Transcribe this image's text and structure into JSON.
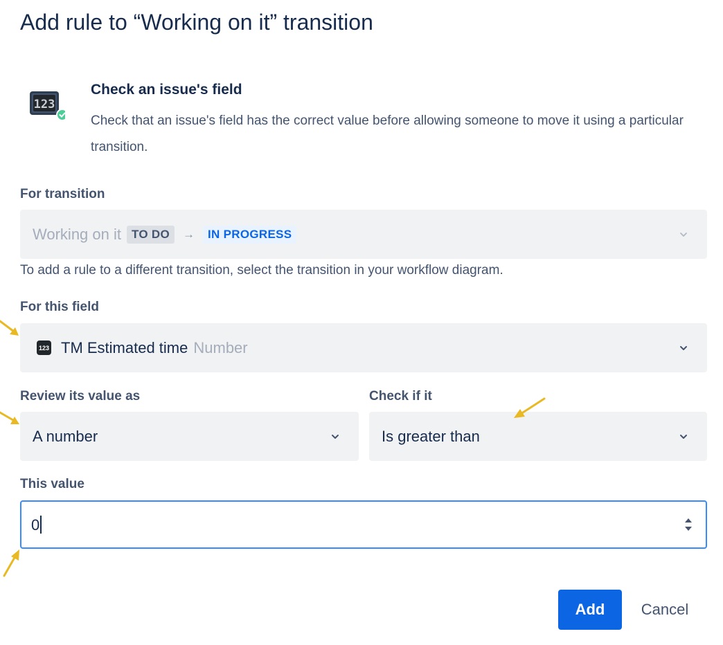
{
  "dialog": {
    "title": "Add rule to “Working on it” transition"
  },
  "rule": {
    "icon": "calculator-check-icon",
    "title": "Check an issue's field",
    "description": "Check that an issue's field has the correct value before allowing someone to move it using a particular transition."
  },
  "transition": {
    "label": "For transition",
    "name": "Working on it",
    "from_status": "TO DO",
    "to_status": "IN PROGRESS",
    "helper": "To add a rule to a different transition, select the transition in your workflow diagram."
  },
  "field": {
    "label": "For this field",
    "icon": "number-field-icon",
    "badge_text": "123",
    "name": "TM Estimated time",
    "type": "Number"
  },
  "review": {
    "label": "Review its value as",
    "value": "A number"
  },
  "check": {
    "label": "Check if it",
    "value": "Is greater than"
  },
  "this_value": {
    "label": "This value",
    "value": "0"
  },
  "actions": {
    "add_label": "Add",
    "cancel_label": "Cancel"
  },
  "colors": {
    "primary": "#0c66e4",
    "focus_border": "#388bff",
    "field_bg": "#f1f2f4",
    "annotation_arrow": "#e8b923"
  }
}
